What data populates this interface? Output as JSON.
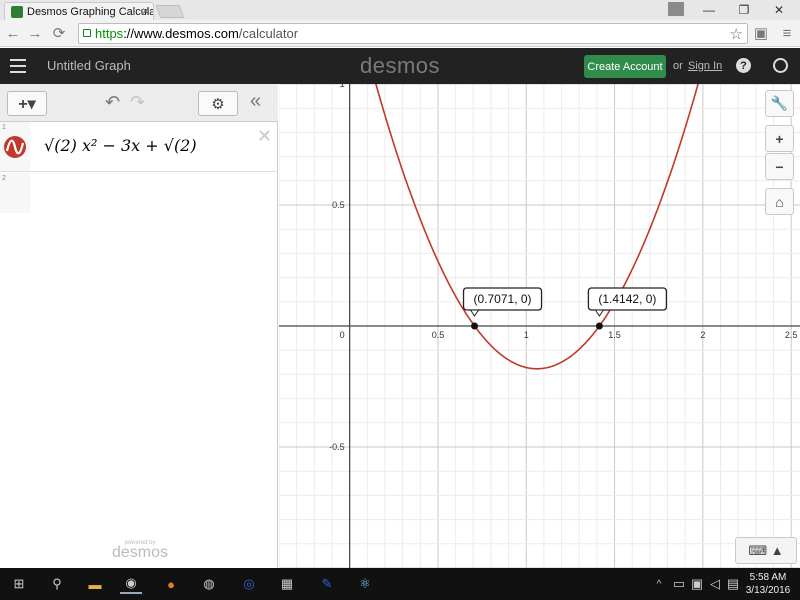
{
  "browser": {
    "tab_title": "Desmos Graphing Calculat",
    "url_https": "https",
    "url_rest_host": "://www.desmos.com",
    "url_path": "/calculator"
  },
  "header": {
    "title": "Untitled Graph",
    "logo": "desmos",
    "create_account": "Create Account",
    "or": "or",
    "sign_in": "Sign In",
    "help": "?"
  },
  "expressions": {
    "rows": [
      {
        "number": "1",
        "latex": "√(2) x² − 3x + √(2)"
      },
      {
        "number": "2",
        "latex": ""
      }
    ],
    "curve_color": "#c0392b"
  },
  "branding": {
    "powered_by": "powered by",
    "name": "desmos"
  },
  "graph": {
    "x_ticks": [
      "0.5",
      "1",
      "1.5",
      "2",
      "2.5"
    ],
    "y_ticks": [
      "1",
      "0.5",
      "-0.5"
    ],
    "origin_label": "0",
    "points": [
      {
        "x": 0.7071,
        "y": 0,
        "label": "(0.7071, 0)"
      },
      {
        "x": 1.4142,
        "y": 0,
        "label": "(1.4142, 0)"
      }
    ],
    "function": {
      "a": 1.41421356,
      "b": -3,
      "c": 1.41421356
    },
    "x_range": [
      -0.4,
      2.55
    ],
    "y_range": [
      -1.0,
      1.0
    ]
  },
  "taskbar": {
    "time": "5:58 AM",
    "date": "3/13/2016"
  }
}
